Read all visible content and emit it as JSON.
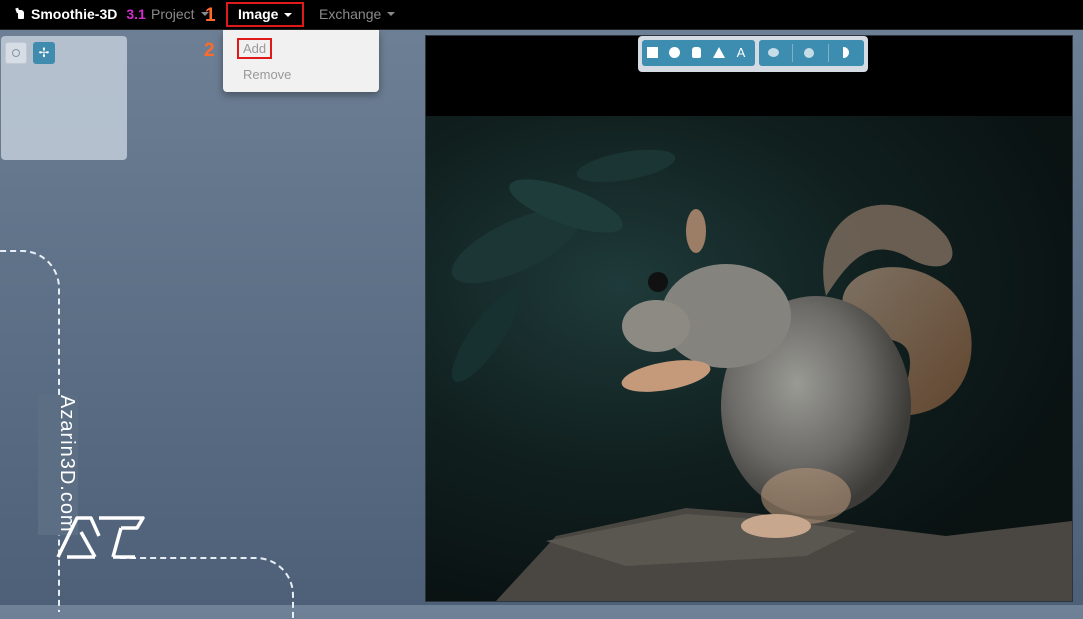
{
  "navbar": {
    "brand_name": "Smoothie-3D",
    "brand_version": "3.1",
    "menus": [
      {
        "label": "Project"
      },
      {
        "label": "Image"
      },
      {
        "label": "Exchange"
      }
    ]
  },
  "annotations": {
    "step1": "1",
    "step2": "2"
  },
  "dropdown": {
    "items": [
      {
        "label": "Add"
      },
      {
        "label": "Remove"
      }
    ]
  },
  "shape_toolbar": {
    "text_tool_label": "A"
  },
  "watermark": {
    "text": "Azarin3D.com"
  },
  "colors": {
    "accent": "#3d8db0",
    "highlight_box": "#e01a1a",
    "annotation_number": "#ff6a2a",
    "version_badge": "#d62bd0"
  },
  "icons": [
    "logo-icon",
    "circle-select-icon",
    "move-icon",
    "square-icon",
    "circle-icon",
    "cylinder-icon",
    "triangle-icon",
    "text-icon",
    "blob-icon",
    "sphere-icon",
    "half-icon",
    "caret-icon"
  ]
}
